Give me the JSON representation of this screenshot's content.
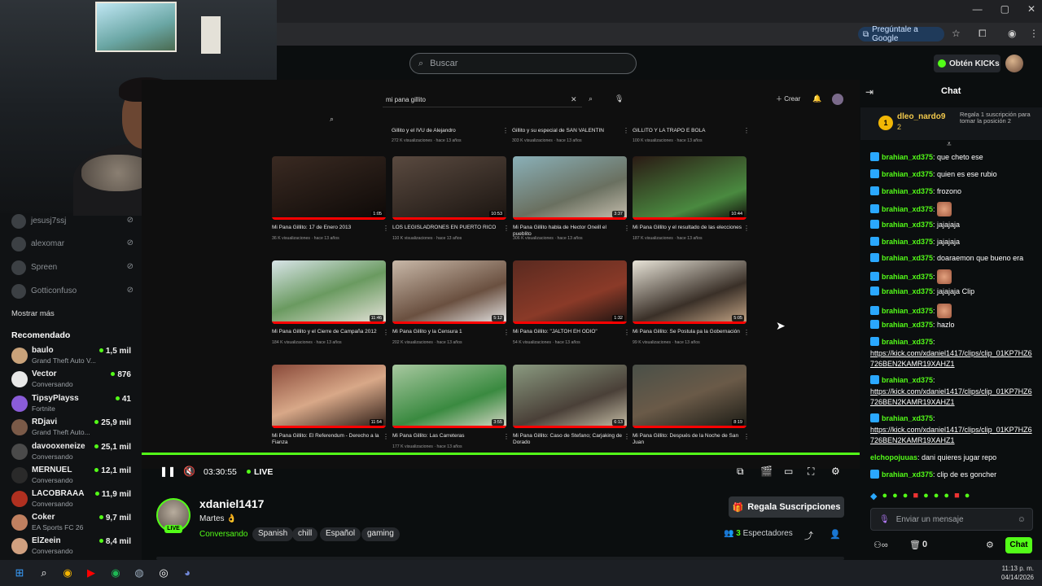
{
  "browser": {
    "gemini_label": "Pregúntale a Google"
  },
  "header": {
    "search_placeholder": "Buscar",
    "kicks_label": "Obtén KICKs"
  },
  "sidebar": {
    "offline": [
      {
        "name": "jesusj7ssj"
      },
      {
        "name": "alexomar"
      },
      {
        "name": "Spreen"
      },
      {
        "name": "Gotticonfuso"
      }
    ],
    "show_more": "Mostrar más",
    "recommended_title": "Recomendado",
    "recommended": [
      {
        "name": "baulo",
        "sub": "Grand Theft Auto V...",
        "count": "1,5 mil",
        "color": "#c9a27a"
      },
      {
        "name": "Vector",
        "sub": "Conversando",
        "count": "876",
        "color": "#e8e8e8"
      },
      {
        "name": "TipsyPlayss",
        "sub": "Fortnite",
        "count": "41",
        "color": "#8a5cd8"
      },
      {
        "name": "RDjavi",
        "sub": "Grand Theft Auto...",
        "count": "25,9 mil",
        "color": "#7a5a48"
      },
      {
        "name": "davooxeneize",
        "sub": "Conversando",
        "count": "25,1 mil",
        "color": "#4a4a4a"
      },
      {
        "name": "MERNUEL",
        "sub": "Conversando",
        "count": "12,1 mil",
        "color": "#2a2a2a"
      },
      {
        "name": "LACOBRAAA",
        "sub": "Conversando",
        "count": "11,9 mil",
        "color": "#b03020"
      },
      {
        "name": "Coker",
        "sub": "EA Sports FC 26",
        "count": "9,7 mil",
        "color": "#c08060"
      },
      {
        "name": "ElZeein",
        "sub": "Conversando",
        "count": "8,4 mil",
        "color": "#d0a080"
      }
    ]
  },
  "youtube": {
    "search_query": "mi pana gillito",
    "create_label": "Crear",
    "top_row": [
      {
        "title": "Gillito y el IVU de Alejandro",
        "meta": "272 K visualizaciones · hace 13 años"
      },
      {
        "title": "Gillito y su especial de SAN VALENTIN",
        "meta": "303 K visualizaciones · hace 13 años"
      },
      {
        "title": "GILLITO Y LA TRAPO E BOLA",
        "meta": "100 K visualizaciones · hace 13 años"
      }
    ],
    "videos": [
      {
        "title": "Mi Pana Gillito: 17 de Enero 2013",
        "meta": "36 K visualizaciones · hace 13 años",
        "dur": "1:05",
        "bg": "linear-gradient(160deg,#3a2a22,#0d0907)"
      },
      {
        "title": "LOS LEGISLADRONES EN PUERTO RICO",
        "meta": "110 K visualizaciones · hace 13 años",
        "dur": "10:53",
        "bg": "linear-gradient(160deg,#5a4a40,#1a1410)"
      },
      {
        "title": "Mi Pana Gillito habla de Hector Oneill el pueblito",
        "meta": "306 K visualizaciones · hace 13 años",
        "dur": "3:37",
        "bg": "linear-gradient(160deg,#8ab0b8,#6a7060 60%,#c8c0b0)"
      },
      {
        "title": "Mi Pana Gillito y el resultado de las elecciones",
        "meta": "187 K visualizaciones · hace 13 años",
        "dur": "10:44",
        "bg": "linear-gradient(160deg,#2a1a14,#4a8a40 70%,#0d0907)"
      },
      {
        "title": "Mi Pana Gillito y el Cierre de Campaña 2012",
        "meta": "184 K visualizaciones · hace 13 años",
        "dur": "11:46",
        "bg": "linear-gradient(160deg,#d8e4e8,#6a9a60 50%,#e8e4dc)"
      },
      {
        "title": "Mi Pana Gillito y la Censura 1",
        "meta": "202 K visualizaciones · hace 13 años",
        "dur": "5:12",
        "bg": "linear-gradient(160deg,#c8b8a8,#6a5040 60%,#e8e8e8)"
      },
      {
        "title": "Mi Pana Gillito: \"JALTOH EH ODIO\"",
        "meta": "54 K visualizaciones · hace 13 años",
        "dur": "1:32",
        "bg": "linear-gradient(160deg,#5a2a20,#8a3a28 60%,#1a1210)"
      },
      {
        "title": "Mi Pana Gillito: Se Postula pa la Gobernación",
        "meta": "99 K visualizaciones · hace 13 años",
        "dur": "5:05",
        "bg": "linear-gradient(160deg,#e8e4d8,#3a3028 60%,#c8a888)"
      },
      {
        "title": "Mi Pana Gillito: El Referendum - Derecho a la Fianza",
        "meta": "",
        "dur": "11:54",
        "bg": "linear-gradient(160deg,#8a4a3a,#d8a888 50%,#2a1a14)"
      },
      {
        "title": "Mi Pana Gillito: Las Carreteras",
        "meta": "177 K visualizaciones · hace 13 años",
        "dur": "3:55",
        "bg": "linear-gradient(160deg,#a8c8a0,#3a8a40 60%,#d8d8c8)"
      },
      {
        "title": "Mi Pana Gillito: Caso de Stefano; Carjaking de Dorado",
        "meta": "",
        "dur": "6:13",
        "bg": "linear-gradient(160deg,#8a9a80,#4a4038 60%,#c8c0a8)"
      },
      {
        "title": "Mi Pana Gillito: Después de la Noche de San Juan",
        "meta": "",
        "dur": "8:19",
        "bg": "linear-gradient(160deg,#4a5048,#6a5a48 50%,#1a1a14)"
      }
    ]
  },
  "player": {
    "time": "03:30:55",
    "live_label": "LIVE"
  },
  "stream": {
    "channel": "xdaniel1417",
    "live_badge": "LIVE",
    "title": "Martes 👌",
    "category": "Conversando",
    "tags": [
      "Spanish",
      "chill",
      "Español",
      "gaming"
    ],
    "gift_label": "Regala Suscripciones",
    "viewers_count": "3",
    "viewers_label": "Espectadores"
  },
  "chat": {
    "title": "Chat",
    "leader": {
      "rank": "1",
      "name": "dleo_nardo9",
      "count": "2",
      "gift_text": "Regala 1 suscripción para tomar la posición 2"
    },
    "messages": [
      {
        "user": "brahian_xd375",
        "text": "que cheto ese"
      },
      {
        "user": "brahian_xd375",
        "text": "quien es ese rubio"
      },
      {
        "user": "brahian_xd375",
        "text": "frozono"
      },
      {
        "user": "brahian_xd375",
        "text": ""
      },
      {
        "user": "brahian_xd375",
        "text": "jajajaja"
      },
      {
        "user": "brahian_xd375",
        "text": "jajajaja"
      },
      {
        "user": "brahian_xd375",
        "text": "doaraemon que bueno era"
      },
      {
        "user": "brahian_xd375",
        "text": ""
      },
      {
        "user": "brahian_xd375",
        "text": "jajajaja Clip"
      },
      {
        "user": "brahian_xd375",
        "text": ""
      },
      {
        "user": "brahian_xd375",
        "text": "hazlo"
      },
      {
        "user": "brahian_xd375",
        "text": "https://kick.com/xdaniel1417/clips/clip_01KP7HZ6726BEN2KAMR19XAHZ1"
      },
      {
        "user": "brahian_xd375",
        "text": "https://kick.com/xdaniel1417/clips/clip_01KP7HZ6726BEN2KAMR19XAHZ1"
      },
      {
        "user": "brahian_xd375",
        "text": "https://kick.com/xdaniel1417/clips/clip_01KP7HZ6726BEN2KAMR19XAHZ1"
      },
      {
        "user": "elchopojuuas",
        "text": "dani quieres jugar repo"
      },
      {
        "user": "brahian_xd375",
        "text": "clip de es goncher"
      }
    ],
    "input_placeholder": "Enviar un mensaje",
    "points": "0",
    "send_label": "Chat"
  },
  "taskbar": {
    "time": "11:13 p. m.",
    "date": "04/14/2026"
  }
}
